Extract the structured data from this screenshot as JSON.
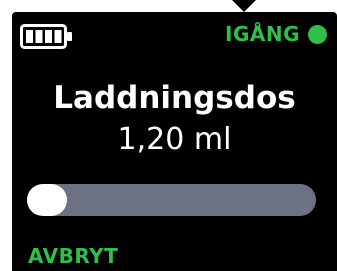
{
  "status": {
    "label": "IGÅNG",
    "icon": "status-dot-icon",
    "color": "#2fbf4a"
  },
  "battery": {
    "icon": "battery-full-icon",
    "level_fraction": 1.0
  },
  "title": "Laddningsdos",
  "dose": "1,20 ml",
  "progress": {
    "fraction": 0.0,
    "track_color": "#6c7184",
    "knob_color": "#ffffff"
  },
  "cancel_label": "AVBRYT",
  "colors": {
    "screen_bg": "#000000",
    "text": "#ffffff",
    "accent": "#2fbf4a"
  }
}
